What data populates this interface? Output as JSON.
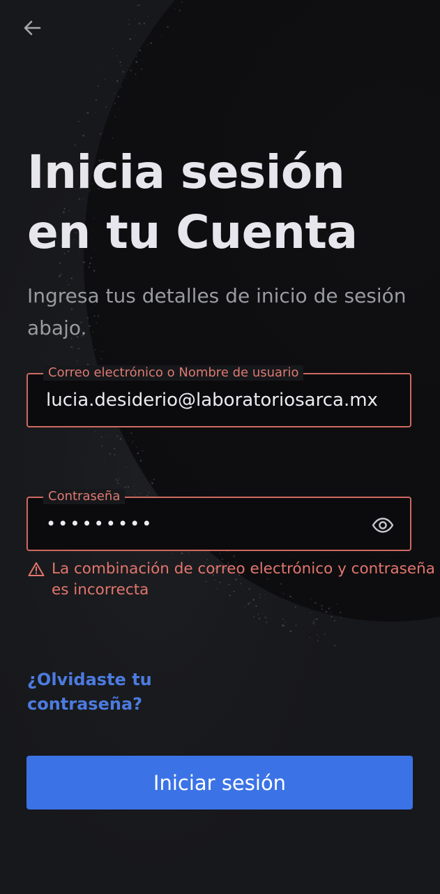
{
  "header": {
    "back_icon": "arrow-left-icon"
  },
  "title": "Inicia sesión en tu Cuenta",
  "subtitle": "Ingresa tus detalles de inicio de sesión abajo.",
  "email_field": {
    "label": "Correo electrónico o Nombre de usuario",
    "value": "lucia.desiderio@laboratoriosarca.mx"
  },
  "password_field": {
    "label": "Contraseña",
    "value": "•••••••••",
    "toggle_icon": "eye-icon"
  },
  "error": {
    "icon": "warning-triangle-icon",
    "message": "La combinación de correo electrónico y contraseña es incorrecta"
  },
  "forgot_password": "¿Olvidaste tu contraseña?",
  "login_button": "Iniciar sesión",
  "colors": {
    "background": "#17181b",
    "error": "#e3766d",
    "link": "#4c7be0",
    "primary_button": "#3b73e6"
  }
}
